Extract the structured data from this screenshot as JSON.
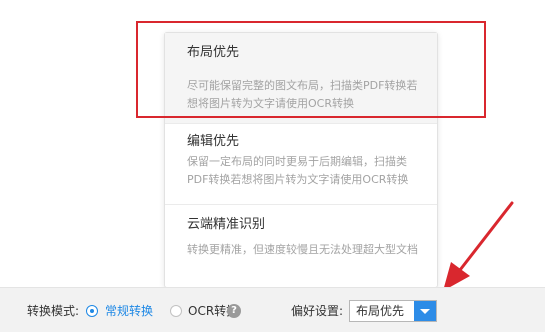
{
  "dropdown": {
    "options": [
      {
        "title": "布局优先",
        "description": "尽可能保留完整的图文布局，扫描类PDF转换若想将图片转为文字请使用OCR转换",
        "selected": true
      },
      {
        "title": "编辑优先",
        "description": "保留一定布局的同时更易于后期编辑，扫描类PDF转换若想将图片转为文字请使用OCR转换",
        "selected": false
      },
      {
        "title": "云端精准识别",
        "description": "转换更精准，但速度较慢且无法处理超大型文档",
        "selected": false
      }
    ]
  },
  "bottom_bar": {
    "mode_label": "转换模式:",
    "mode_options": [
      {
        "label": "常规转换",
        "checked": true
      },
      {
        "label": "OCR转换",
        "checked": false
      }
    ],
    "help_icon": "?",
    "pref_label": "偏好设置:",
    "pref_value": "布局优先"
  },
  "annotation": {
    "highlight_color": "#d9272e",
    "arrow_color": "#d9272e"
  },
  "colors": {
    "accent": "#1e88e5",
    "select_button": "#2d8ce7"
  }
}
